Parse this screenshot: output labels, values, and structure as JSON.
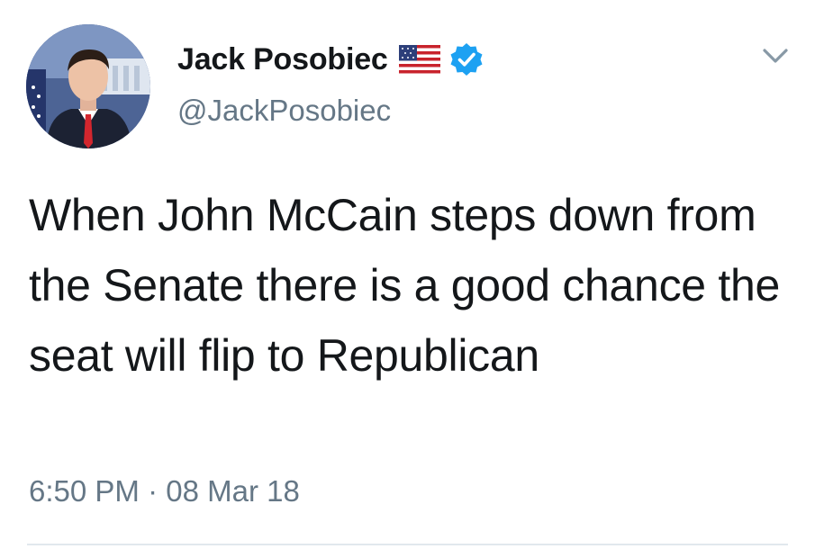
{
  "tweet": {
    "author": {
      "display_name": "Jack Posobiec",
      "handle": "@JackPosobiec",
      "flag_icon": "us-flag-icon",
      "verified_icon": "verified-badge-icon",
      "verified_color": "#1da1f2"
    },
    "text": "When John McCain steps down from the Senate there is a good chance the seat will flip to Republican",
    "timestamp": "6:50 PM · 08 Mar 18",
    "menu_icon": "chevron-down-icon"
  },
  "colors": {
    "primary_text": "#14171a",
    "secondary_text": "#657786",
    "divider": "#e1e8ed"
  }
}
